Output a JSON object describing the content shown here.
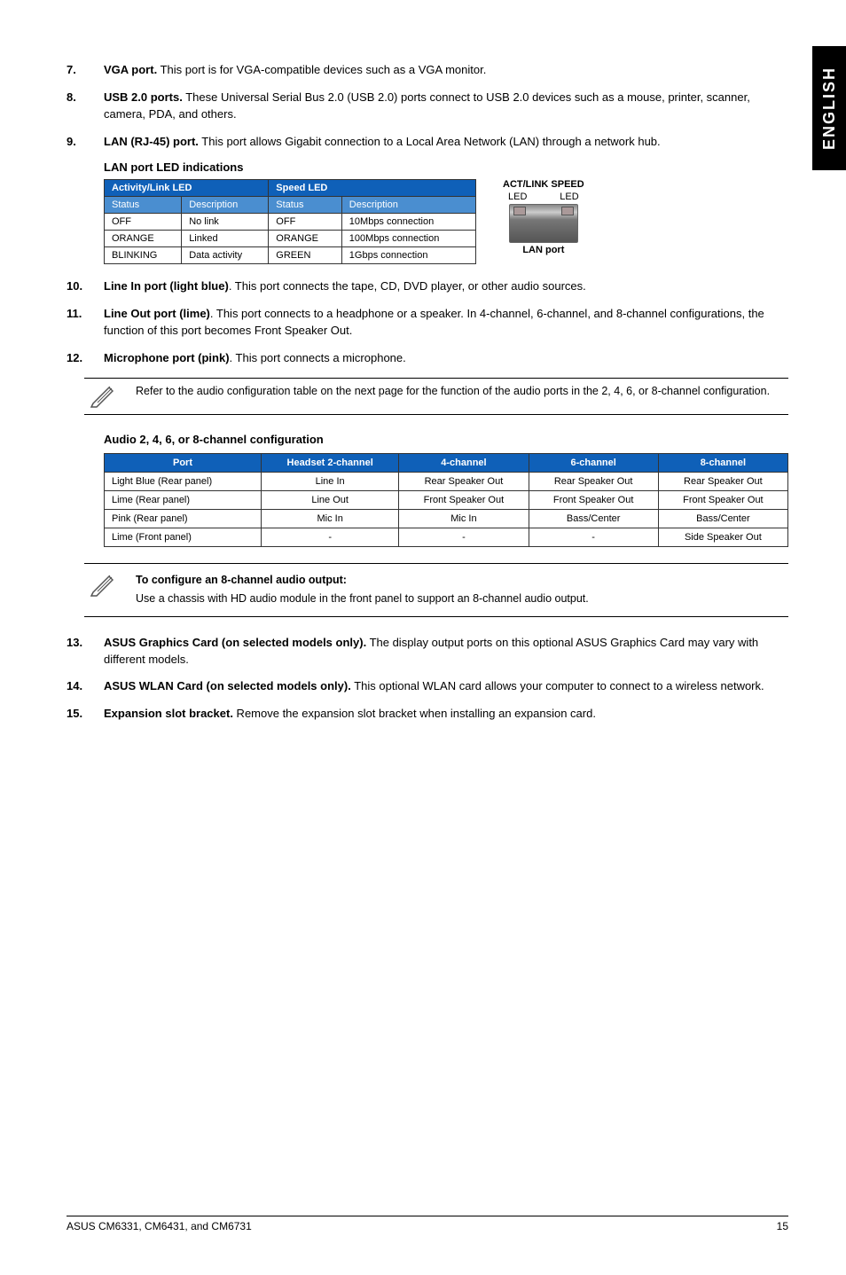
{
  "sidetab": "ENGLISH",
  "items": {
    "n7": {
      "num": "7.",
      "lead": "VGA port.",
      "text": " This port is for VGA-compatible devices such as a VGA monitor."
    },
    "n8": {
      "num": "8.",
      "lead": "USB 2.0 ports.",
      "text": " These Universal Serial Bus 2.0 (USB 2.0) ports connect to USB 2.0 devices such as a mouse, printer, scanner, camera, PDA, and others."
    },
    "n9": {
      "num": "9.",
      "lead": "LAN (RJ-45) port.",
      "text": " This port allows Gigabit connection to a Local Area Network (LAN) through a network hub."
    },
    "n10": {
      "num": "10.",
      "lead": "Line In port (light blue)",
      "text": ". This port connects the tape, CD, DVD player, or other audio sources."
    },
    "n11": {
      "num": "11.",
      "lead": "Line Out port (lime)",
      "text": ". This port connects to a headphone or a speaker. In 4-channel, 6-channel, and 8-channel configurations, the function of this port becomes Front Speaker Out."
    },
    "n12": {
      "num": "12.",
      "lead": "Microphone port (pink)",
      "text": ". This port connects a microphone."
    },
    "n13": {
      "num": "13.",
      "lead": "ASUS Graphics Card (on selected models only).",
      "text": " The display output ports on this optional ASUS Graphics Card may vary with different models."
    },
    "n14": {
      "num": "14.",
      "lead": "ASUS WLAN Card (on selected models only).",
      "text": " This optional WLAN card allows your computer to connect to a wireless network."
    },
    "n15": {
      "num": "15.",
      "lead": "Expansion slot bracket.",
      "text": " Remove the expansion slot bracket when installing an expansion card."
    }
  },
  "led": {
    "title": "LAN port LED indications",
    "h_activity": "Activity/Link LED",
    "h_speed": "Speed LED",
    "h_status": "Status",
    "h_desc": "Description",
    "rows": [
      {
        "s1": "OFF",
        "d1": "No link",
        "s2": "OFF",
        "d2": "10Mbps connection"
      },
      {
        "s1": "ORANGE",
        "d1": "Linked",
        "s2": "ORANGE",
        "d2": "100Mbps connection"
      },
      {
        "s1": "BLINKING",
        "d1": "Data activity",
        "s2": "GREEN",
        "d2": "1Gbps connection"
      }
    ],
    "diagram": {
      "top1": "ACT/LINK",
      "top2": "SPEED",
      "led": "LED",
      "label": "LAN port"
    }
  },
  "note1": "Refer to the audio configuration table on the next page for the function of the audio ports in the 2, 4, 6, or 8-channel configuration.",
  "audio": {
    "title": "Audio 2, 4, 6, or 8-channel configuration",
    "headers": [
      "Port",
      "Headset 2-channel",
      "4-channel",
      "6-channel",
      "8-channel"
    ],
    "rows": [
      [
        "Light Blue (Rear panel)",
        "Line In",
        "Rear Speaker Out",
        "Rear Speaker Out",
        "Rear Speaker Out"
      ],
      [
        "Lime (Rear panel)",
        "Line Out",
        "Front Speaker Out",
        "Front Speaker Out",
        "Front Speaker Out"
      ],
      [
        "Pink (Rear panel)",
        "Mic In",
        "Mic In",
        "Bass/Center",
        "Bass/Center"
      ],
      [
        "Lime (Front panel)",
        "-",
        "-",
        "-",
        "Side Speaker Out"
      ]
    ]
  },
  "note2": {
    "title": "To configure an 8-channel audio output:",
    "text": "Use a chassis with HD audio module in the front panel to support an 8-channel audio output."
  },
  "footer": {
    "left": "ASUS CM6331, CM6431, and CM6731",
    "right": "15"
  }
}
